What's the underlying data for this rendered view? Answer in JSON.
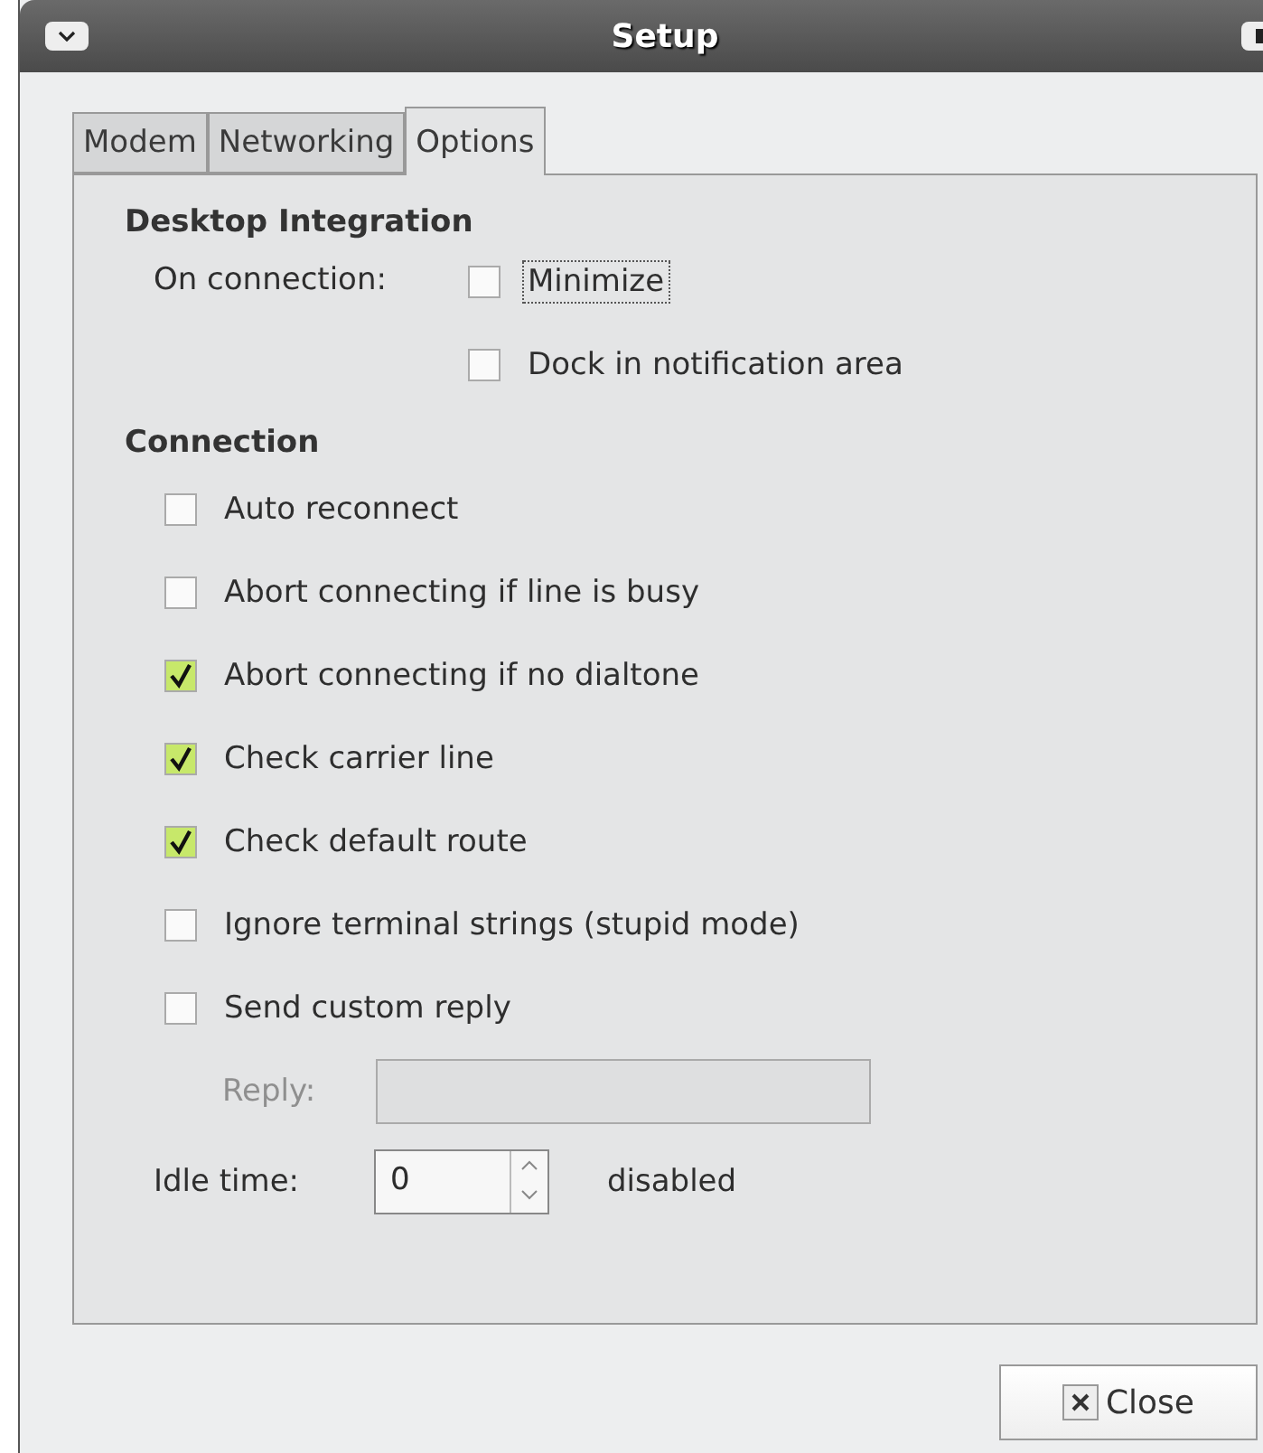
{
  "window": {
    "title": "Setup"
  },
  "tabs": [
    {
      "label": "Modem",
      "selected": false
    },
    {
      "label": "Networking",
      "selected": false
    },
    {
      "label": "Options",
      "selected": true
    }
  ],
  "desktop_integration": {
    "heading": "Desktop Integration",
    "label": "On connection:",
    "options": [
      {
        "label": "Minimize",
        "checked": false,
        "focused": true
      },
      {
        "label": "Dock in notification area",
        "checked": false,
        "focused": false
      }
    ]
  },
  "connection": {
    "heading": "Connection",
    "options": [
      {
        "label": "Auto reconnect",
        "checked": false
      },
      {
        "label": "Abort connecting if line is busy",
        "checked": false
      },
      {
        "label": "Abort connecting if no dialtone",
        "checked": true
      },
      {
        "label": "Check carrier line",
        "checked": true
      },
      {
        "label": "Check default route",
        "checked": true
      },
      {
        "label": "Ignore terminal strings (stupid mode)",
        "checked": false
      },
      {
        "label": "Send custom reply",
        "checked": false
      }
    ],
    "reply": {
      "label": "Reply:",
      "disabled": true
    },
    "idle_time": {
      "label": "Idle time:",
      "value": "0",
      "note": "disabled"
    }
  },
  "buttons": [
    {
      "label": "Close"
    }
  ]
}
